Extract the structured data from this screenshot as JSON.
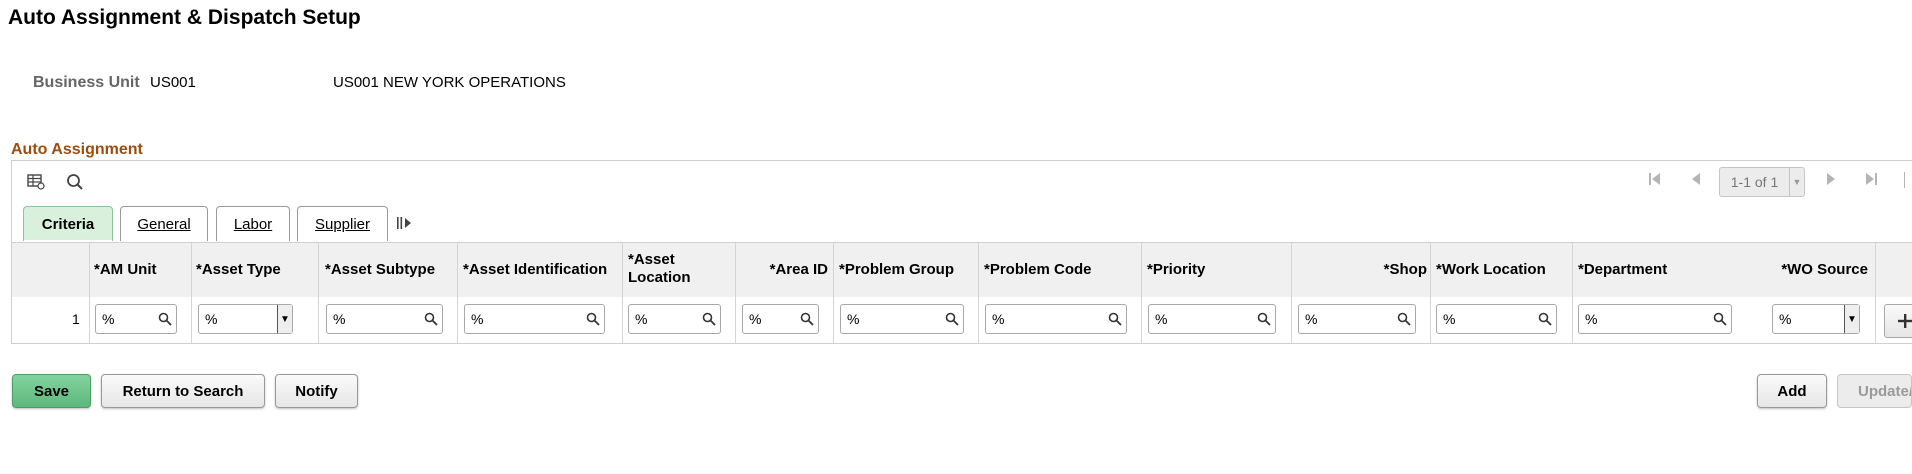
{
  "page": {
    "title": "Auto Assignment & Dispatch Setup"
  },
  "business_unit": {
    "label": "Business Unit",
    "value": "US001",
    "description": "US001 NEW YORK OPERATIONS"
  },
  "section": {
    "title": "Auto Assignment"
  },
  "grid": {
    "pager_text": "1-1 of 1",
    "tabs": [
      {
        "label": "Criteria",
        "active": true
      },
      {
        "label": "General",
        "active": false
      },
      {
        "label": "Labor",
        "active": false
      },
      {
        "label": "Supplier",
        "active": false
      }
    ],
    "columns": [
      "*AM Unit",
      "*Asset Type",
      "*Asset Subtype",
      "*Asset Identification",
      "*Asset Location",
      "*Area ID",
      "*Problem Group",
      "*Problem Code",
      "*Priority",
      "*Shop",
      "*Work Location",
      "*Department",
      "*WO Source"
    ],
    "rows": [
      {
        "num": "1",
        "am_unit": "%",
        "asset_type": "%",
        "asset_subtype": "%",
        "asset_identification": "%",
        "asset_location": "%",
        "area_id": "%",
        "problem_group": "%",
        "problem_code": "%",
        "priority": "%",
        "shop": "%",
        "work_location": "%",
        "department": "%",
        "wo_source": "%"
      }
    ]
  },
  "buttons": {
    "save": "Save",
    "return_to_search": "Return to Search",
    "notify": "Notify",
    "add": "Add",
    "update": "Update/"
  },
  "icons": {
    "personalize": "table-settings-icon",
    "find": "search-icon",
    "first": "first-page-icon",
    "prev": "previous-page-icon",
    "next": "next-page-icon",
    "last": "last-page-icon",
    "show_all_columns": "column-expand-icon",
    "lookup": "magnifier-icon",
    "add_row": "plus-icon"
  },
  "colors": {
    "section_title": "#9c4e0f",
    "active_tab": "#d8f0dc",
    "primary_button": "#5cb97c"
  }
}
